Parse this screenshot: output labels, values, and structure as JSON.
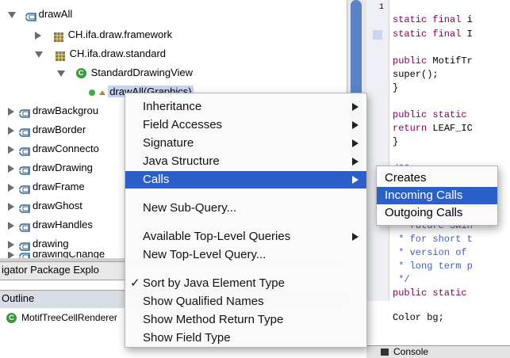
{
  "tree": {
    "rows": [
      {
        "label": "drawAll",
        "kind": "method",
        "expanded": true
      },
      {
        "label": "CH.ifa.draw.framework",
        "kind": "package",
        "expanded": false
      },
      {
        "label": "CH.ifa.draw.standard",
        "kind": "package",
        "expanded": true
      },
      {
        "label": "StandardDrawingView",
        "kind": "class",
        "expanded": true
      },
      {
        "label": "drawAll(Graphics)",
        "kind": "method-leaf"
      },
      {
        "label": "drawBackgrou",
        "kind": "method"
      },
      {
        "label": "drawBorder",
        "kind": "method"
      },
      {
        "label": "drawConnecto",
        "kind": "method"
      },
      {
        "label": "drawDrawing",
        "kind": "method"
      },
      {
        "label": "drawFrame",
        "kind": "method"
      },
      {
        "label": "drawGhost",
        "kind": "method"
      },
      {
        "label": "drawHandles",
        "kind": "method"
      },
      {
        "label": "drawing",
        "kind": "method"
      },
      {
        "label": "drawingChange",
        "kind": "method"
      }
    ]
  },
  "views": {
    "tabs_text": "igator Package Explo",
    "outline_title": "Outline",
    "outline_item": "MotifTreeCellRenderer",
    "class_icon_letter": "C",
    "console_title": "Console"
  },
  "editor": {
    "lines": [
      "static final i",
      "static final I",
      "",
      "public MotifTr",
      "super();",
      "}",
      "",
      "public static",
      "return LEAF_IC",
      "}",
      "",
      "/**",
      "",
      "",
      "",
      " * future Swin",
      " * for short t",
      " * version of",
      " * long term p",
      " */",
      "public static",
      "",
      "Color bg;"
    ]
  },
  "context_menu": {
    "items": [
      {
        "label": "Inheritance",
        "submenu": true
      },
      {
        "label": "Field Accesses",
        "submenu": true
      },
      {
        "label": "Signature",
        "submenu": true
      },
      {
        "label": "Java Structure",
        "submenu": true
      },
      {
        "label": "Calls",
        "submenu": true,
        "selected": true
      },
      {
        "label": "New Sub-Query..."
      },
      {
        "label": "Available Top-Level Queries",
        "submenu": true
      },
      {
        "label": "New Top-Level Query..."
      },
      {
        "label": "Sort by Java Element Type",
        "checked": true
      },
      {
        "label": "Show Qualified Names"
      },
      {
        "label": "Show Method Return Type"
      },
      {
        "label": "Show Field Type"
      }
    ],
    "check_mark": "✓"
  },
  "submenu": {
    "items": [
      {
        "label": "Creates"
      },
      {
        "label": "Incoming Calls",
        "selected": true
      },
      {
        "label": "Outgoing Calls"
      }
    ]
  },
  "colors": {
    "selection": "#2b5fc9",
    "class_icon": "#3a9a3a",
    "method_icon": "#2e6a9e"
  }
}
